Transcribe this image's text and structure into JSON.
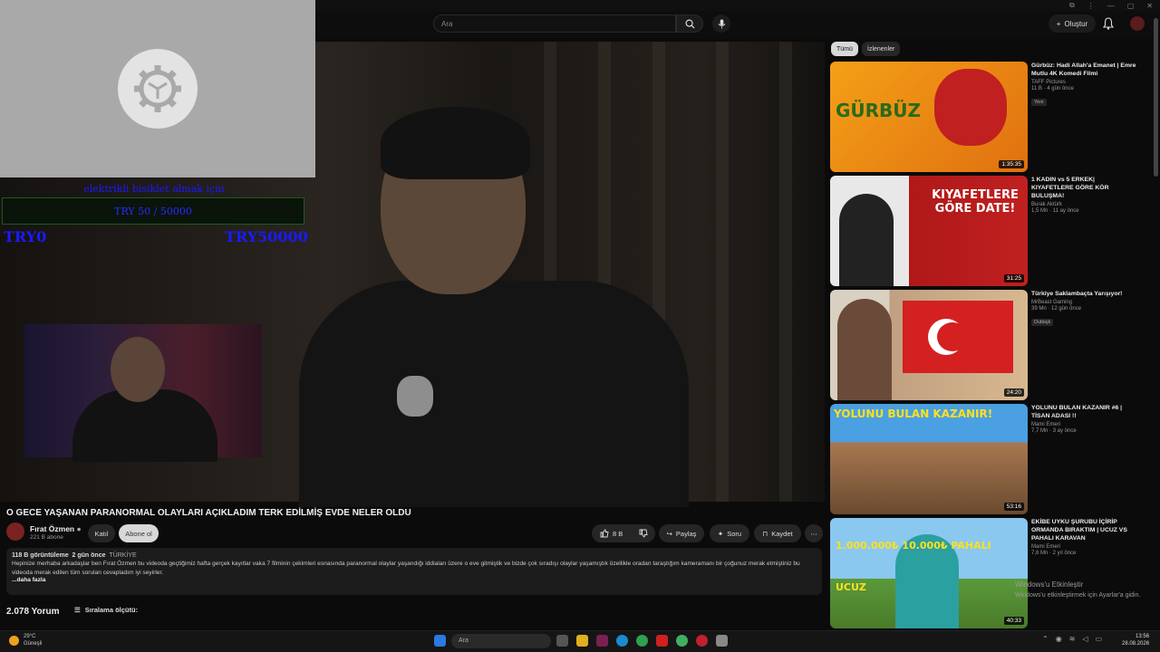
{
  "browser": {
    "icons": [
      "⧉",
      "⋮",
      "—",
      "▢",
      "✕"
    ]
  },
  "header": {
    "search_placeholder": "Ara",
    "create_label": "Oluştur"
  },
  "overlay": {
    "donation_title": "elektrikli bisiklet almak için",
    "donation_progress": "TRY 50 / 50000",
    "donation_min": "TRY0",
    "donation_max": "TRY50000"
  },
  "video": {
    "title": "O GECE YAŞANAN PARANORMAL OLAYLARI AÇIKLADIM TERK EDİLMİŞ EVDE NELER OLDU",
    "channel_name": "Fırat Özmen",
    "channel_subs": "221 B abone",
    "join_label": "Katıl",
    "subscribe_label": "Abone ol",
    "likes": "8 B",
    "share_label": "Paylaş",
    "ask_label": "Soru",
    "save_label": "Kaydet",
    "views": "118 B görüntüleme",
    "age": "2 gün önce",
    "country": "TÜRKİYE",
    "description": "Hepinize merhaba arkadaşlar ben Fırat Özmen bu videoda geçtiğimiz hafta gerçek kayıtlar vaka 7 filminin çekimleri esnasında paranormal olaylar yaşandığı iddiaları üzere o eve gitmiştik ve bizde çok sıradışı olaylar yaşamıştık özellikle oradan taraştığım kameramanı bir çoğunuz merak etmiştiniz bu videoda merak edilen tüm sorulan cevapladım iyi seyirler.",
    "more_label": "...daha fazla",
    "comments_count": "2.078 Yorum",
    "sort_label": "Sıralama ölçütü:"
  },
  "sidebar": {
    "chips": [
      "Tümü",
      "İzlenenler"
    ],
    "cards": [
      {
        "title": "Gürbüz: Hadi Allah'a Emanet | Emre Mutlu 4K Komedi Filmi",
        "channel": "TAFF Pictures",
        "stats": "11 B · 4 gün önce",
        "badge": "Yeni",
        "duration": "1:35:35",
        "thumb_text": "GÜRBÜZ"
      },
      {
        "title": "1 KADIN vs 5 ERKEK| KIYAFETLERE GÖRE KÖR BULUŞMA!",
        "channel": "Burak Aktürk",
        "stats": "1,5 Mn · 11 ay önce",
        "badge": "",
        "duration": "31:25",
        "thumb_text": "KIYAFETLERE GÖRE DATE!"
      },
      {
        "title": "Türkiye Saklambaçta Yarışıyor!",
        "channel": "MrBeast Gaming",
        "stats": "39 Mn · 12 gün önce",
        "badge": "Dublajlı",
        "duration": "24:20",
        "thumb_text": ""
      },
      {
        "title": "YOLUNU BULAN KAZANIR #6 | TİSAN ADASI !!",
        "channel": "Mami Emeri",
        "stats": "7,7 Mn · 3 ay önce",
        "badge": "",
        "duration": "53:16",
        "thumb_text": "YOLUNU BULAN KAZANIR!"
      },
      {
        "title": "EKİBE UYKU ŞURUBU İÇİRİP ORMANDA BIRAKTIM | UCUZ VS PAHALI KARAVAN",
        "channel": "Mami Emeri",
        "stats": "7,6 Mn · 2 yıl önce",
        "badge": "",
        "duration": "40:33",
        "thumb_text": "1.000.000₺ 10.000₺ PAHALI UCUZ"
      }
    ]
  },
  "windows_notice": {
    "line1": "Windows'u Etkinleştir",
    "line2": "Windows'u etkinleştirmek için Ayarlar'a gidin."
  },
  "taskbar": {
    "temp": "29°C",
    "weather": "Güneşli",
    "search_placeholder": "Ara",
    "time": "13:56",
    "date": "28.08.2026"
  },
  "colors": {
    "accent": "#1a1aff",
    "bg": "#0b0b0b",
    "panel": "#1c1c1c"
  }
}
